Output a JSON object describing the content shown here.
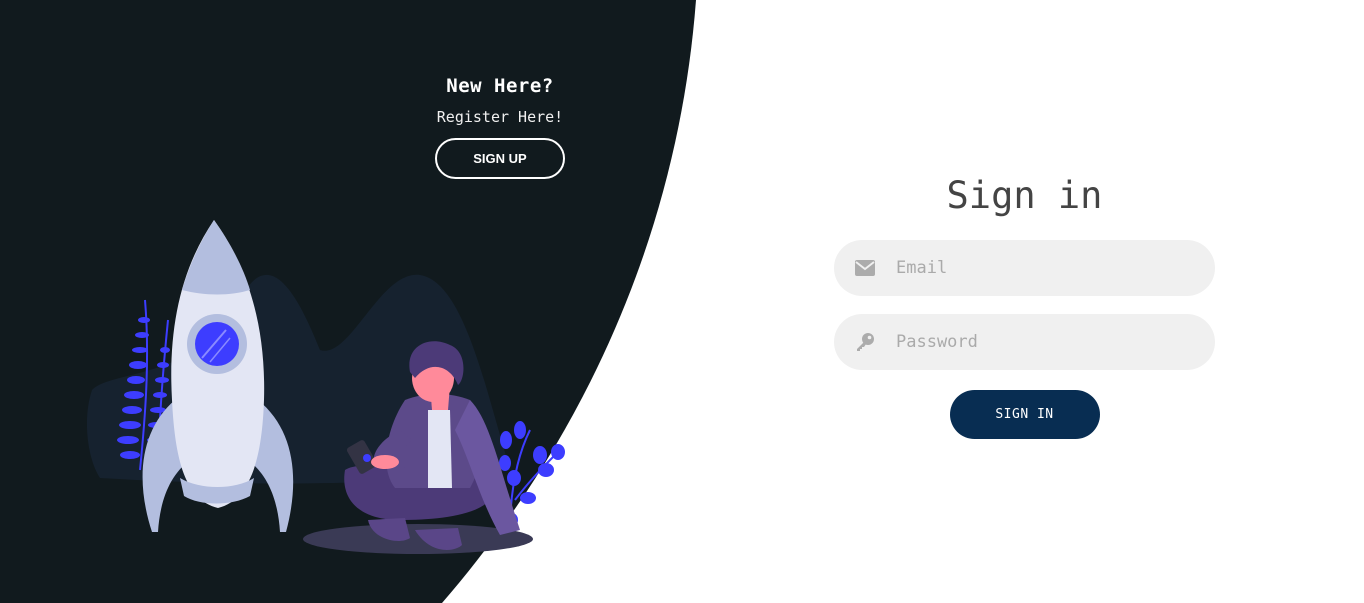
{
  "left_panel": {
    "title": "New Here?",
    "subtitle": "Register Here!",
    "signup_label": "SIGN UP"
  },
  "signin": {
    "title": "Sign in",
    "email_placeholder": "Email",
    "password_placeholder": "Password",
    "button_label": "SIGN IN"
  },
  "colors": {
    "panel_bg": "#111a1e",
    "button_bg": "#082d52",
    "input_bg": "#f0f0f0",
    "accent": "#3d3dff"
  },
  "icons": {
    "email": "envelope-icon",
    "password": "key-icon"
  }
}
